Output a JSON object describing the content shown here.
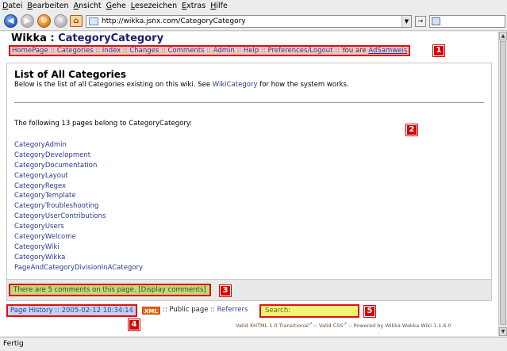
{
  "menubar": {
    "items": [
      "Datei",
      "Bearbeiten",
      "Ansicht",
      "Gehe",
      "Lesezeichen",
      "Extras",
      "Hilfe"
    ]
  },
  "toolbar": {
    "url": "http://wikka.jsnx.com/CategoryCategory"
  },
  "header": {
    "site_name": "Wikka : ",
    "page_title": "CategoryCategory",
    "nav": [
      "HomePage",
      "Categories",
      "Index",
      "Changes",
      "Comments",
      "Admin",
      "Help",
      "Preferences/Logout"
    ],
    "you_are": "You are",
    "user": "AdSamweis"
  },
  "markers": [
    "1",
    "2",
    "3",
    "4",
    "5"
  ],
  "content": {
    "heading": "List of All Categories",
    "intro_before": "Below is the list of all Categories existing on this wiki. See ",
    "intro_link": "WikiCategory",
    "intro_after": " for how the system works.",
    "count_text": "The following 13 pages belong to CategoryCategory:",
    "categories": [
      "CategoryAdmin",
      "CategoryDevelopment",
      "CategoryDocumentation",
      "CategoryLayout",
      "CategoryRegex",
      "CategoryTemplate",
      "CategoryTroubleshooting",
      "CategoryUserContributions",
      "CategoryUsers",
      "CategoryWelcome",
      "CategoryWiki",
      "CategoryWikka",
      "PageAndCategoryDivisionInACategory"
    ]
  },
  "comments": {
    "text": "There are 5 comments on this page. ",
    "link": "[Display comments]"
  },
  "footer": {
    "history": "Page History :: 2005-02-12 10:34:14",
    "xml": "XML",
    "public": " :: Public page :: ",
    "referrers": "Referrers",
    "search_label": "Search:",
    "valid_xhtml": "Valid XHTML 1.0 Transitional",
    "valid_css": "Valid CSS",
    "powered": "Powered by Wikka Wakka Wiki 1.1.6.0"
  },
  "status": {
    "text": "Fertig"
  }
}
